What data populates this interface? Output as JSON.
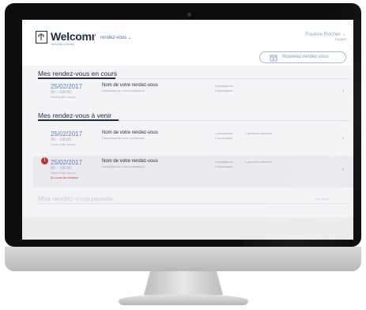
{
  "app": {
    "brand": "Welcomr",
    "brand_sub": "security-concept",
    "nav_select": "rendez-vous",
    "user": {
      "name": "Pauline Rocher",
      "role": "Equipe"
    },
    "new_button": "Nouveau rendez-vous"
  },
  "sections": {
    "current": {
      "title": "Mes rendez-vous en cours"
    },
    "upcoming": {
      "title": "Mes rendez-vous à venir"
    },
    "past": {
      "title": "Mes rendez-vous passés",
      "link": "Voir plus"
    }
  },
  "rows": [
    {
      "date": "25/02/2017",
      "time": "9h - 18h30",
      "sub": "Client & Site Xxxxxx",
      "name": "Nom de votre rendez-vous",
      "desc": "Description de votre evenement",
      "participants": "4 participants",
      "respondents": "2 répondants",
      "absent": "",
      "status": ""
    },
    {
      "date": "25/02/2017",
      "time": "9h - 18h30",
      "sub": "Client & Site Xxxxxx",
      "name": "Nom de votre rendez-vous",
      "desc": "Description de votre evenement",
      "participants": "4 participants",
      "respondents": "2 répondants",
      "absent": "1 personne absente",
      "status": ""
    },
    {
      "date": "25/02/2017",
      "time": "9h - 18h30",
      "sub": "Client & Site Xxxxxx",
      "name": "Nom de votre rendez-vous",
      "desc": "Description de votre evenement",
      "participants": "4 participants",
      "respondents": "2 répondants",
      "absent": "1 personne absente",
      "status": "En cours de création"
    }
  ],
  "icons": {
    "alert": "!",
    "chevron": "›",
    "nav_caret": "⌄",
    "user_caret": "⌄"
  },
  "colors": {
    "brand_dark": "#1f2a44",
    "link_blue": "#5f7ec4",
    "alert_red": "#c43030"
  }
}
